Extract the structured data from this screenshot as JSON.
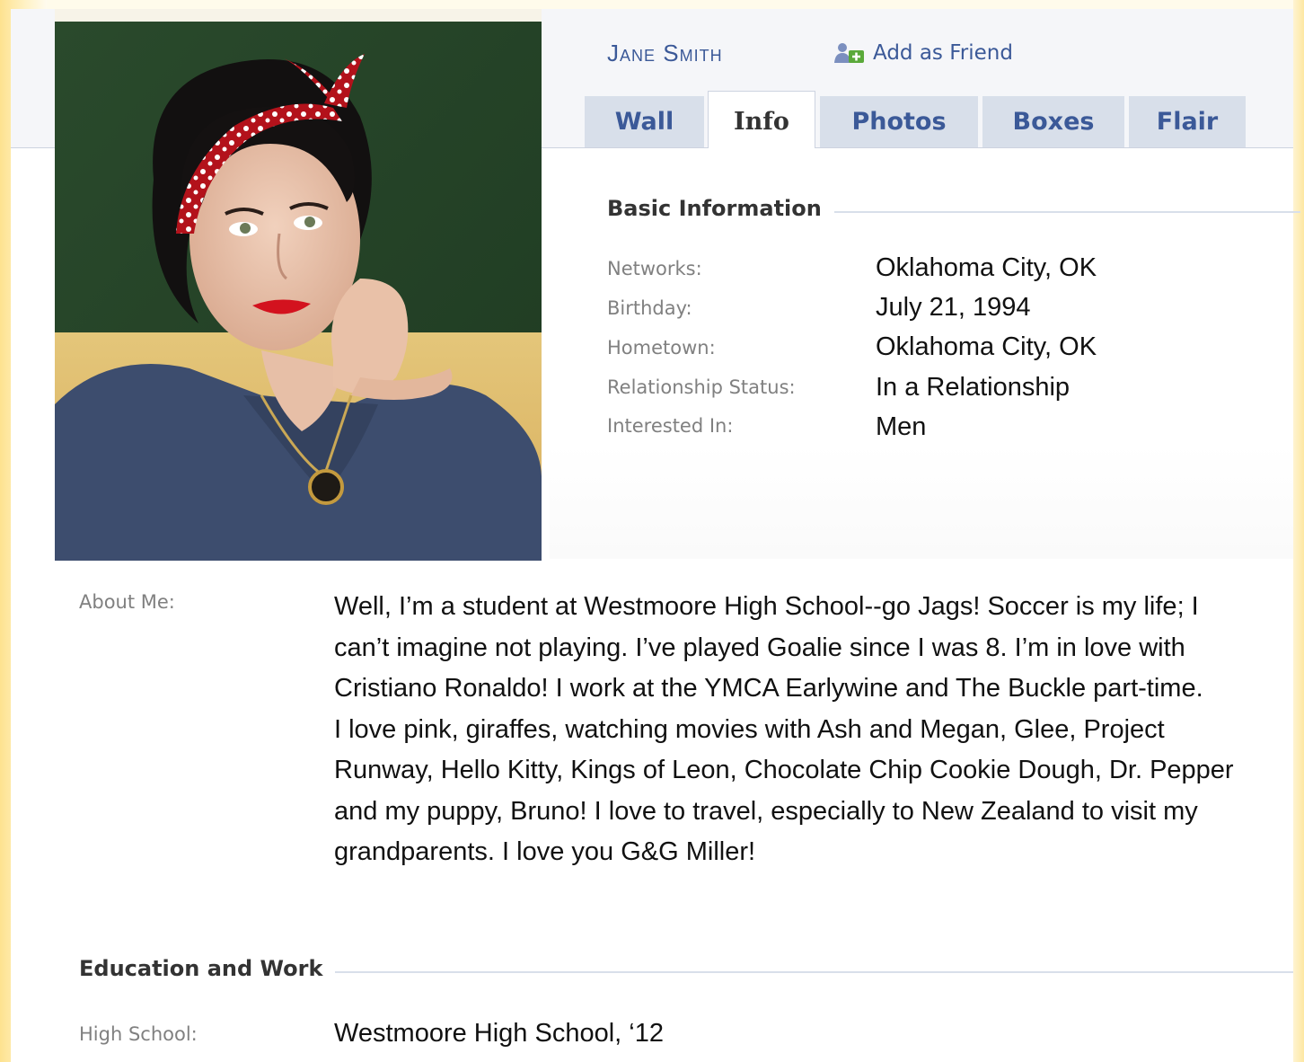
{
  "profile": {
    "name": "Jane Smith",
    "add_friend_label": "Add as Friend",
    "photo_icon": "profile-photo"
  },
  "tabs": [
    {
      "label": "Wall",
      "active": false
    },
    {
      "label": "Info",
      "active": true
    },
    {
      "label": "Photos",
      "active": false
    },
    {
      "label": "Boxes",
      "active": false
    },
    {
      "label": "Flair",
      "active": false
    }
  ],
  "basic_info": {
    "title": "Basic Information",
    "rows": [
      {
        "label": "Networks:",
        "value": "Oklahoma City, OK"
      },
      {
        "label": "Birthday:",
        "value": "July 21, 1994"
      },
      {
        "label": "Hometown:",
        "value": "Oklahoma City, OK"
      },
      {
        "label": "Relationship Status:",
        "value": "In a Relationship"
      },
      {
        "label": "Interested In:",
        "value": "Men"
      }
    ]
  },
  "about": {
    "label": "About Me:",
    "lines": [
      "Well, I’m a student at Westmoore High School--go Jags! Soccer is my life; I",
      "can’t imagine not playing. I’ve played Goalie since I was 8. I’m in love with",
      "Cristiano Ronaldo! I work at the YMCA Earlywine and The Buckle part-time.",
      "I love pink, giraffes, watching movies with Ash and Megan, Glee, Project",
      "Runway, Hello Kitty, Kings of Leon, Chocolate Chip Cookie Dough, Dr. Pepper",
      "and my puppy, Bruno! I love to travel, especially to New Zealand to visit my",
      "grandparents. I love you G&G Miller!"
    ]
  },
  "education": {
    "title": "Education and Work",
    "rows": [
      {
        "label": "High School:",
        "value": "Westmoore High School, ‘12"
      }
    ]
  },
  "colors": {
    "link": "#3b5998",
    "tab_bg": "#d8dfea",
    "label_gray": "#808080",
    "frame_yellow": "#fde28f"
  }
}
